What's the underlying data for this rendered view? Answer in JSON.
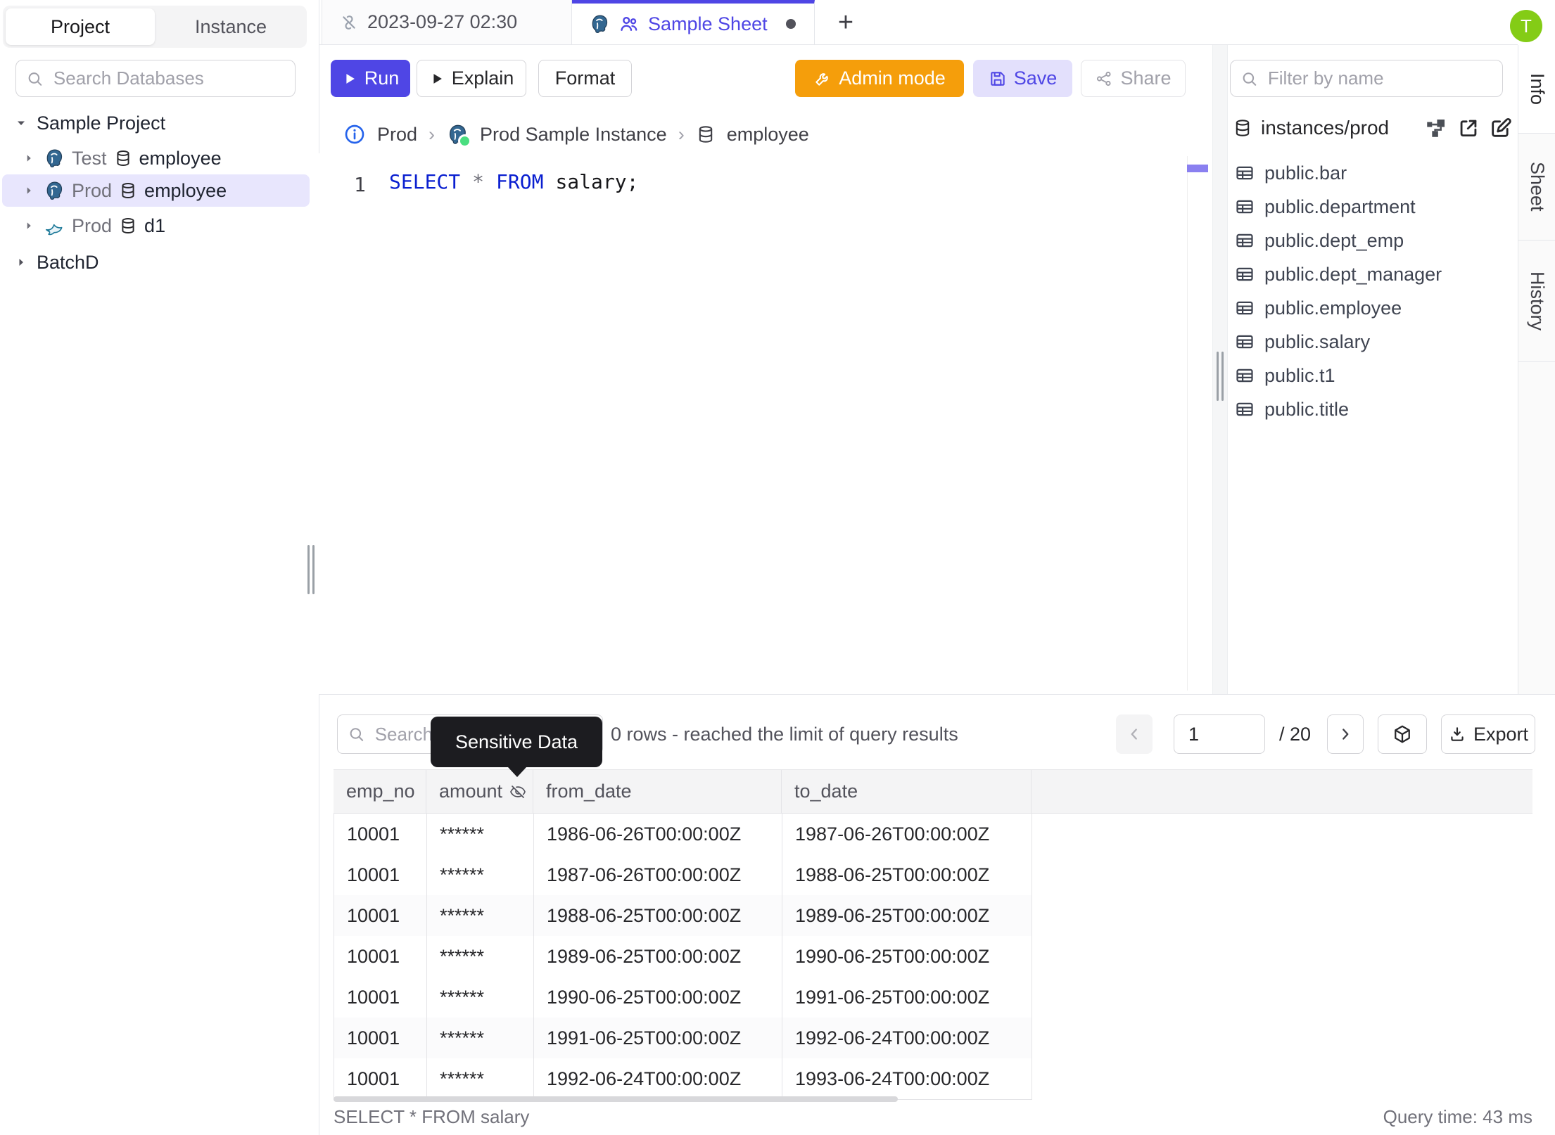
{
  "left_sidebar": {
    "tabs": {
      "project": "Project",
      "instance": "Instance"
    },
    "search_placeholder": "Search Databases",
    "tree": {
      "project_label": "Sample Project",
      "items": [
        {
          "env": "Test",
          "db": "employee",
          "engine": "postgresql"
        },
        {
          "env": "Prod",
          "db": "employee",
          "engine": "postgresql"
        },
        {
          "env": "Prod",
          "db": "d1",
          "engine": "mysql"
        }
      ],
      "collapsed_project": "BatchD"
    }
  },
  "editor_tabs": {
    "tab_timestamp": "2023-09-27 02:30",
    "tab_sheet": "Sample Sheet",
    "new_tab": "+"
  },
  "toolbar": {
    "run": "Run",
    "explain": "Explain",
    "format": "Format",
    "admin_mode": "Admin mode",
    "save": "Save",
    "share": "Share"
  },
  "breadcrumb": {
    "env": "Prod",
    "instance": "Prod Sample Instance",
    "database": "employee",
    "separator": "›"
  },
  "editor": {
    "line_number": "1",
    "sql": {
      "kw1": "SELECT",
      "star": "*",
      "kw2": "FROM",
      "rest": "salary;"
    }
  },
  "right_sidebar": {
    "filter_placeholder": "Filter by name",
    "scope": "instances/prod",
    "tables": [
      "public.bar",
      "public.department",
      "public.dept_emp",
      "public.dept_manager",
      "public.employee",
      "public.salary",
      "public.t1",
      "public.title"
    ]
  },
  "side_tabs": {
    "info": "Info",
    "sheet": "Sheet",
    "history": "History"
  },
  "avatar": {
    "initial": "T"
  },
  "results": {
    "search_placeholder": "Search",
    "tooltip": "Sensitive Data",
    "summary": "0 rows  -  reached the limit of query results",
    "page": "1",
    "page_total": "/ 20",
    "export": "Export",
    "columns": [
      "emp_no",
      "amount",
      "from_date",
      "to_date"
    ],
    "rows": [
      {
        "emp_no": "10001",
        "amount": "******",
        "from_date": "1986-06-26T00:00:00Z",
        "to_date": "1987-06-26T00:00:00Z"
      },
      {
        "emp_no": "10001",
        "amount": "******",
        "from_date": "1987-06-26T00:00:00Z",
        "to_date": "1988-06-25T00:00:00Z"
      },
      {
        "emp_no": "10001",
        "amount": "******",
        "from_date": "1988-06-25T00:00:00Z",
        "to_date": "1989-06-25T00:00:00Z"
      },
      {
        "emp_no": "10001",
        "amount": "******",
        "from_date": "1989-06-25T00:00:00Z",
        "to_date": "1990-06-25T00:00:00Z"
      },
      {
        "emp_no": "10001",
        "amount": "******",
        "from_date": "1990-06-25T00:00:00Z",
        "to_date": "1991-06-25T00:00:00Z"
      },
      {
        "emp_no": "10001",
        "amount": "******",
        "from_date": "1991-06-25T00:00:00Z",
        "to_date": "1992-06-24T00:00:00Z"
      },
      {
        "emp_no": "10001",
        "amount": "******",
        "from_date": "1992-06-24T00:00:00Z",
        "to_date": "1993-06-24T00:00:00Z"
      }
    ],
    "status_left": "SELECT * FROM salary",
    "status_right": "Query time: 43 ms"
  },
  "colors": {
    "accent_indigo": "#4f46e5",
    "admin_orange": "#f59e0b",
    "save_bg": "#e3e0fc",
    "selected_row_bg": "#e8e6fd",
    "avatar_green": "#84cc16",
    "tooltip_bg": "#1c1c20",
    "keyword_blue": "#0a1fd0"
  }
}
